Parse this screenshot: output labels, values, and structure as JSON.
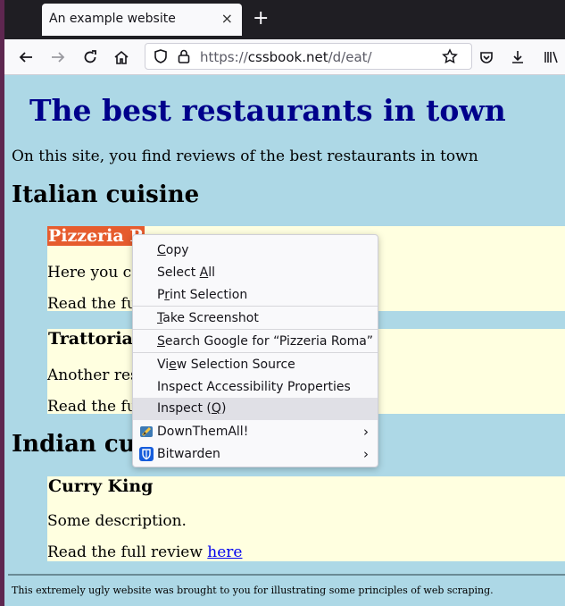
{
  "browser": {
    "tab_title": "An example website",
    "tab_close": "×",
    "new_tab": "+",
    "url_prefix": "https://",
    "url_domain": "cssbook.net",
    "url_path": "/d/eat/"
  },
  "page": {
    "title": "The best restaurants in town",
    "intro": "On this site, you find reviews of the best restaurants in town",
    "sections": [
      {
        "heading": "Italian cuisine",
        "cards": [
          {
            "name": "Pizzeria R",
            "desc": "Here you ca",
            "review": "Read the ful"
          },
          {
            "name": "Trattoria",
            "desc": "Another res",
            "review": "Read the ful"
          }
        ]
      },
      {
        "heading": "Indian cui",
        "cards": [
          {
            "name": "Curry King",
            "desc": "Some description.",
            "review": "Read the full review ",
            "link": "here"
          }
        ]
      }
    ],
    "footer": "This extremely ugly website was brought to you for illustrating some principles of web scraping."
  },
  "context_menu": {
    "items": [
      {
        "pre": "",
        "u": "C",
        "post": "opy"
      },
      {
        "pre": "Select ",
        "u": "A",
        "post": "ll"
      },
      {
        "pre": "P",
        "u": "r",
        "post": "int Selection"
      },
      {
        "pre": "",
        "u": "T",
        "post": "ake Screenshot"
      },
      {
        "pre": "",
        "u": "S",
        "post": "earch Google for “Pizzeria Roma”"
      },
      {
        "pre": "Vi",
        "u": "e",
        "post": "w Selection Source"
      },
      {
        "pre": "Inspect Accessibility Properties",
        "u": "",
        "post": ""
      },
      {
        "pre": "Inspect (",
        "u": "Q",
        "post": ")"
      },
      {
        "pre": "DownThemAll!",
        "u": "",
        "post": ""
      },
      {
        "pre": "Bitwarden",
        "u": "",
        "post": ""
      }
    ],
    "submenu_arrow": "›"
  },
  "colors": {
    "page_bg": "#add8e6",
    "card_bg": "#ffffe0",
    "title": "#00008b",
    "selection": "#e65c2e",
    "menu_hover": "#e0e0e6"
  }
}
